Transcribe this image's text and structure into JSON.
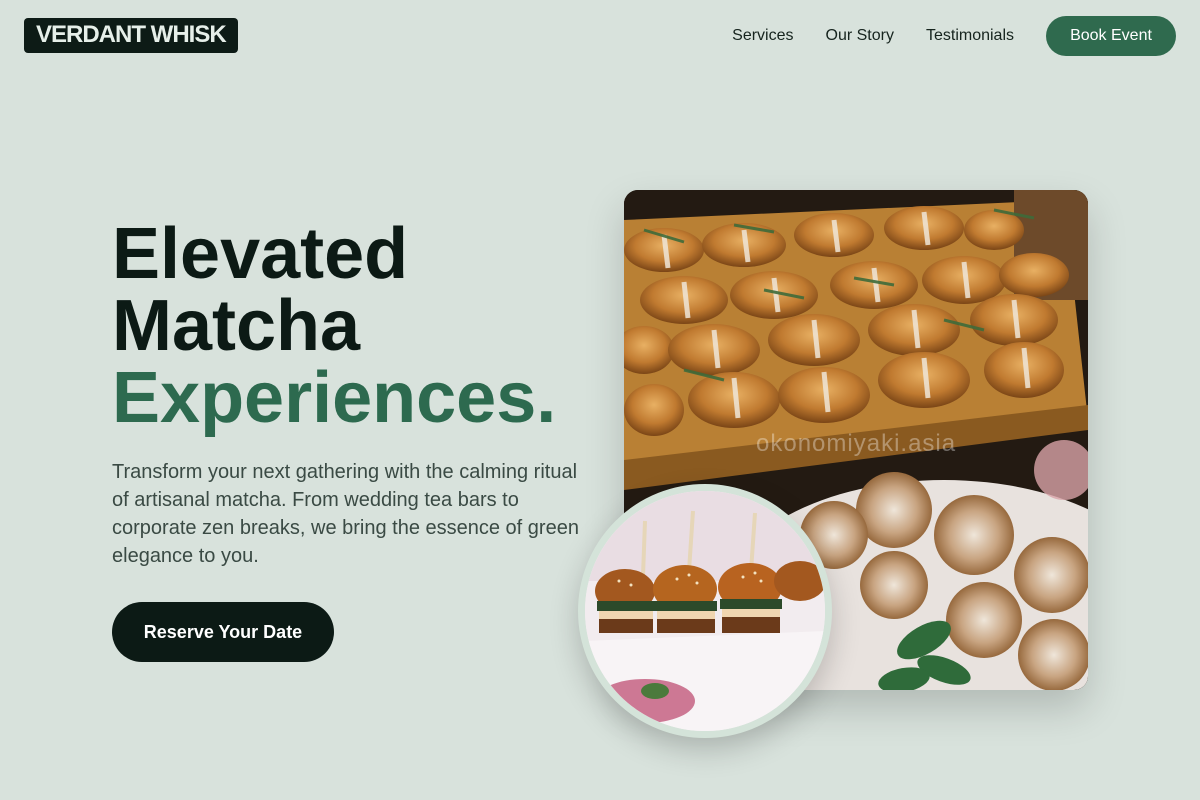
{
  "brand": {
    "logo_text": "VERDANT WHISK"
  },
  "nav": {
    "links": [
      "Services",
      "Our Story",
      "Testimonials"
    ],
    "cta_label": "Book Event"
  },
  "hero": {
    "headline_line1": "Elevated",
    "headline_line2": "Matcha",
    "headline_accent": "Experiences.",
    "description": "Transform your next gathering with the calming ritual of artisanal matcha. From wedding tea bars to corporate zen breaks, we bring the essence of green elegance to you.",
    "cta_label": "Reserve Your Date"
  },
  "images": {
    "main_watermark": "okonomiyaki.asia"
  },
  "colors": {
    "background": "#d8e2dc",
    "brand_dark": "#0c1a15",
    "brand_green": "#2d6a4f"
  }
}
